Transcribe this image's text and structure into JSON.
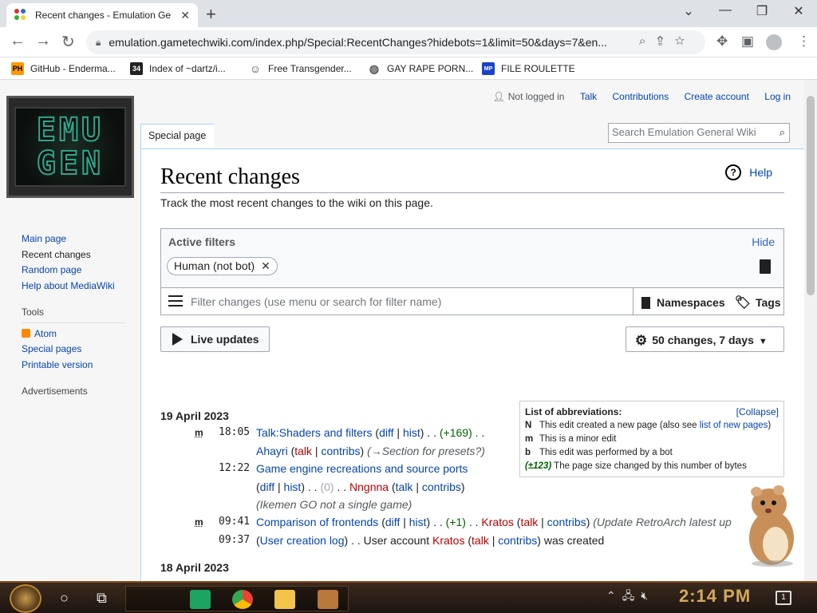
{
  "browser": {
    "tab_title": "Recent changes - Emulation Ge",
    "url": "emulation.gametechwiki.com/index.php/Special:RecentChanges?hidebots=1&limit=50&days=7&en...",
    "bookmarks": [
      {
        "icon_text": "PH",
        "icon_color": "#f90",
        "label": "GitHub - Enderma..."
      },
      {
        "icon_text": "34",
        "icon_color": "#222",
        "label": "Index of ~dartz/i..."
      },
      {
        "icon_text": "☺",
        "icon_color": "#666",
        "label": "Free Transgender..."
      },
      {
        "icon_text": "◍",
        "icon_color": "#555",
        "label": "GAY RAPE PORN..."
      },
      {
        "icon_text": "MP",
        "icon_color": "#1a44c8",
        "label": "FILE ROULETTE"
      }
    ]
  },
  "logo": {
    "line1": "EMU",
    "line2": "GEN"
  },
  "personal": {
    "not_logged_in": "Not logged in",
    "talk": "Talk",
    "contributions": "Contributions",
    "create_account": "Create account",
    "log_in": "Log in"
  },
  "tab": {
    "special_page": "Special page"
  },
  "search": {
    "placeholder": "Search Emulation General Wiki"
  },
  "sidebar": {
    "nav": [
      "Main page",
      "Recent changes",
      "Random page",
      "Help about MediaWiki"
    ],
    "tools_heading": "Tools",
    "tools": [
      "Atom",
      "Special pages",
      "Printable version"
    ],
    "ads_heading": "Advertisements"
  },
  "page": {
    "title": "Recent changes",
    "help": "Help",
    "intro": "Track the most recent changes to the wiki on this page."
  },
  "filters": {
    "active_label": "Active filters",
    "hide": "Hide",
    "chip": "Human (not bot)",
    "search_placeholder": "Filter changes (use menu or search for filter name)",
    "namespaces": "Namespaces",
    "tags": "Tags",
    "live_updates": "Live updates",
    "changes_summary": "50 changes, 7 days"
  },
  "legend": {
    "title": "List of abbreviations:",
    "collapse": "[Collapse]",
    "rows": [
      {
        "key": "N",
        "text": "This edit created a new page (also see ",
        "link": "list of new pages",
        "after": ")"
      },
      {
        "key": "m",
        "text": "This is a minor edit"
      },
      {
        "key": "b",
        "text": "This edit was performed by a bot"
      },
      {
        "key": "(±123)",
        "text": "The page size changed by this number of bytes"
      }
    ]
  },
  "days": [
    {
      "date": "19 April 2023",
      "entries": [
        {
          "minor": "m",
          "time": "18:05",
          "page": "Talk:Shaders and filters",
          "diff": "diff",
          "hist": "hist",
          "size": "(+169)",
          "user": "Ahayri",
          "talk": "talk",
          "contribs": "contribs",
          "comment": "(→Section for presets?)"
        },
        {
          "minor": "",
          "time": "12:22",
          "page": "Game engine recreations and source ports",
          "diff": "diff",
          "hist": "hist",
          "size": "(0)",
          "user": "Nngnna",
          "talk": "talk",
          "contribs": "contribs",
          "comment": "(Ikemen GO not a single game)"
        },
        {
          "minor": "m",
          "time": "09:41",
          "page": "Comparison of frontends",
          "diff": "diff",
          "hist": "hist",
          "size": "(+1)",
          "user": "Kratos",
          "talk": "talk",
          "contribs": "contribs",
          "comment": "(Update RetroArch latest up"
        },
        {
          "minor": "",
          "time": "09:37",
          "log": "User creation log",
          "action": ". . User account",
          "user": "Kratos",
          "talk": "talk",
          "contribs": "contribs",
          "result": "was created"
        }
      ]
    },
    {
      "date": "18 April 2023",
      "entries": []
    }
  ],
  "taskbar": {
    "clock": "2:14 PM",
    "notifications": "1"
  }
}
